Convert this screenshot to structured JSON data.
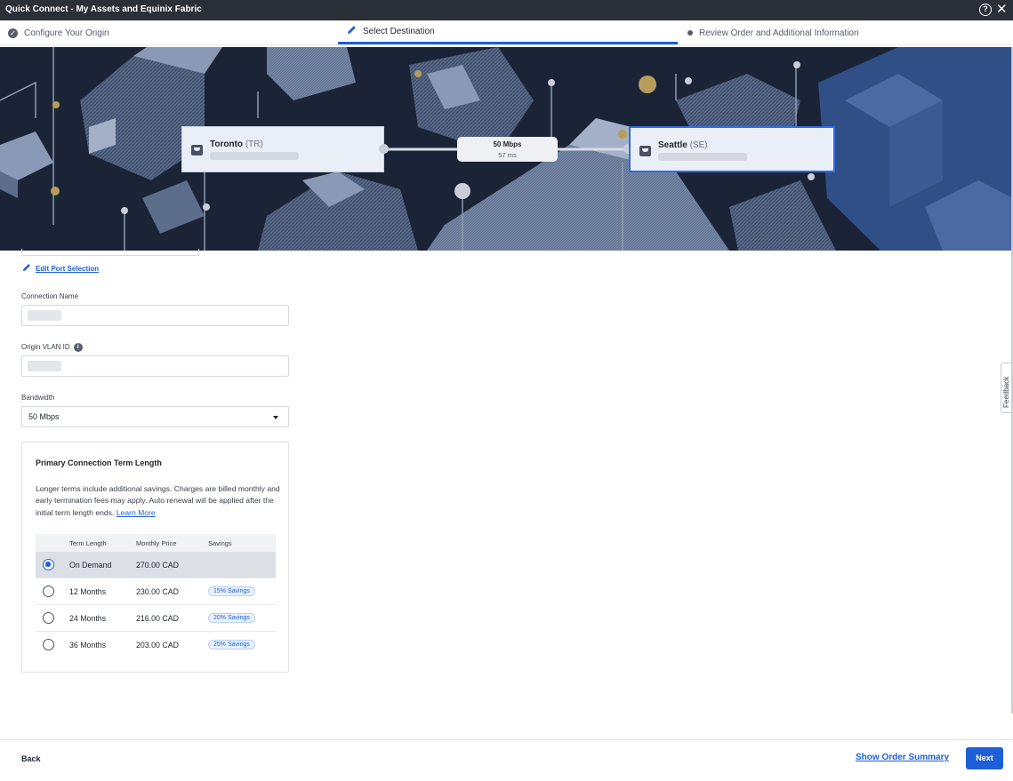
{
  "window": {
    "title": "Quick Connect - My Assets and Equinix Fabric"
  },
  "stepper": {
    "steps": [
      {
        "label": "Configure Your Origin"
      },
      {
        "label": "Select Destination"
      },
      {
        "label": "Review Order and Additional Information"
      }
    ]
  },
  "banner": {
    "origin": {
      "name": "Toronto",
      "code": "(TR)"
    },
    "destination": {
      "name": "Seattle",
      "code": "(SE)"
    },
    "link": {
      "bandwidth": "50 Mbps",
      "latency": "57 ms"
    }
  },
  "form": {
    "edit_port_label": "Edit Port Selection",
    "connection_name_label": "Connection Name",
    "origin_vlan_label": "Origin VLAN ID",
    "bandwidth_label": "Bandwidth",
    "bandwidth_value": "50 Mbps"
  },
  "term": {
    "title": "Primary Connection Term Length",
    "description": "Longer terms include additional savings. Charges are billed monthly and early termination fees may apply. Auto renewal will be applied after the initial term length ends.",
    "learn_more": "Learn More",
    "headers": [
      "Term Length",
      "Monthly Price",
      "Savings"
    ],
    "rows": [
      {
        "term": "On Demand",
        "price": "270.00 CAD",
        "savings": "",
        "selected": true
      },
      {
        "term": "12 Months",
        "price": "230.00 CAD",
        "savings": "15% Savings",
        "selected": false
      },
      {
        "term": "24 Months",
        "price": "216.00 CAD",
        "savings": "20% Savings",
        "selected": false
      },
      {
        "term": "36 Months",
        "price": "203.00 CAD",
        "savings": "25% Savings",
        "selected": false
      }
    ]
  },
  "feedback_label": "Feedback",
  "footer": {
    "back_label": "Back",
    "summary_label": "Show Order Summary",
    "next_label": "Next"
  },
  "colors": {
    "accent": "#1e5fd8",
    "banner_bg": "#1b2437",
    "titlebar": "#2b2f36"
  }
}
